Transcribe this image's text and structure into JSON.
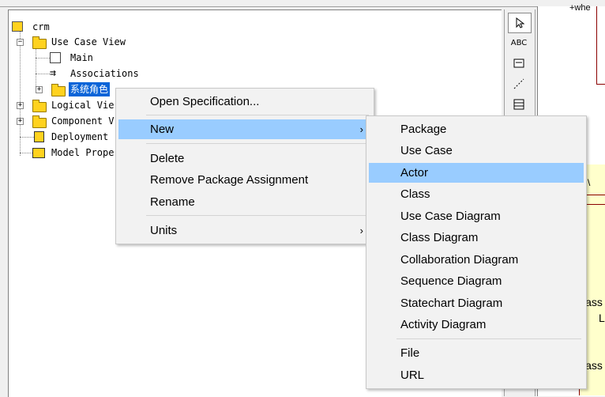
{
  "tree": {
    "root": "crm",
    "use_case_view": "Use Case View",
    "main": "Main",
    "associations": "Associations",
    "package_selected": "系统角色",
    "logical_view": "Logical Vie",
    "component_view": "Component V",
    "deployment": "Deployment",
    "model_props": "Model Prope"
  },
  "toolbox": {
    "text_tool": "ABC"
  },
  "diagram": {
    "text_top": "+whe",
    "text_1": "lass",
    "text_2": "L",
    "text_3": "lass",
    "text_4": "\\"
  },
  "context_menu": {
    "open_spec": "Open Specification...",
    "new": "New",
    "delete": "Delete",
    "remove_pkg": "Remove Package Assignment",
    "rename": "Rename",
    "units": "Units",
    "arrow": "›"
  },
  "submenu": {
    "package": "Package",
    "use_case": "Use Case",
    "actor": "Actor",
    "class": "Class",
    "use_case_diagram": "Use Case Diagram",
    "class_diagram": "Class Diagram",
    "collab_diagram": "Collaboration Diagram",
    "sequence_diagram": "Sequence Diagram",
    "statechart_diagram": "Statechart Diagram",
    "activity_diagram": "Activity Diagram",
    "file": "File",
    "url": "URL"
  },
  "colors": {
    "selection": "#0a64d8",
    "menu_highlight": "#99ccff",
    "folder": "#ffd21f"
  }
}
